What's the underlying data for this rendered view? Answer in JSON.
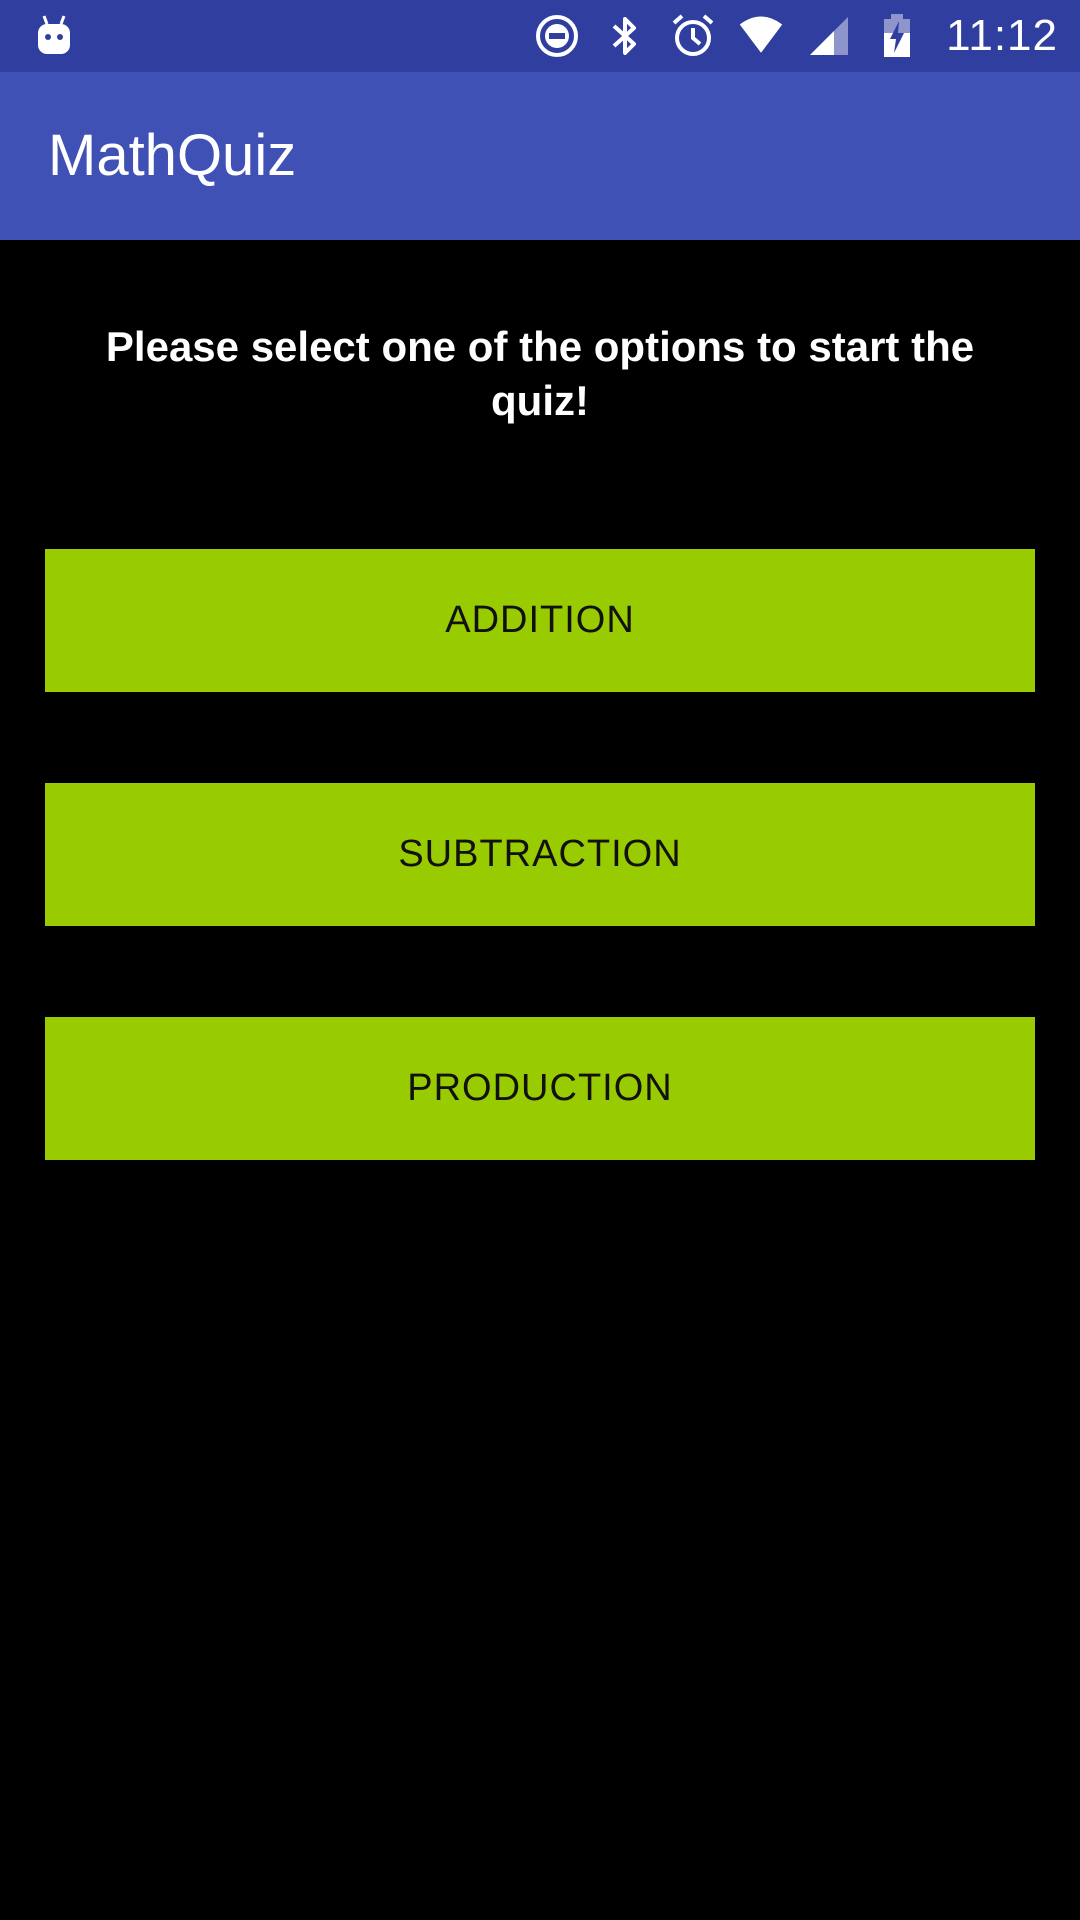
{
  "status_bar": {
    "time": "11:12",
    "icons": [
      "android-debug-icon",
      "do-not-disturb-icon",
      "bluetooth-icon",
      "alarm-icon",
      "wifi-icon",
      "cell-signal-icon",
      "battery-charging-icon"
    ]
  },
  "app_bar": {
    "title": "MathQuiz"
  },
  "main": {
    "prompt": "Please select one of the options to start the quiz!",
    "buttons": [
      {
        "label": "ADDITION"
      },
      {
        "label": "SUBTRACTION"
      },
      {
        "label": "PRODUCTION"
      }
    ]
  },
  "colors": {
    "status_bar": "#303F9F",
    "app_bar": "#3F51B5",
    "background": "#000000",
    "button": "#99CC00",
    "button_text": "#111111"
  }
}
